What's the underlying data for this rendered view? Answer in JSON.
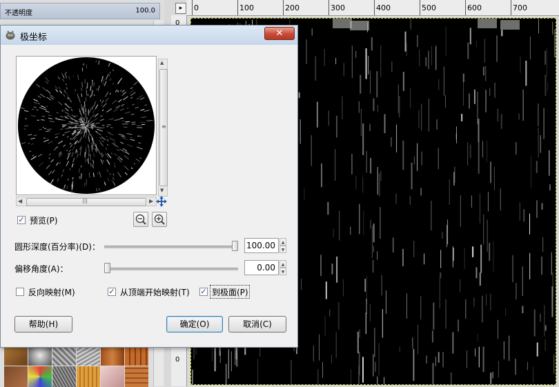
{
  "background": {
    "layers_panel": {
      "opacity_label": "不透明度",
      "opacity_value": "100.0"
    },
    "ruler": {
      "top_labels": [
        "0",
        "100",
        "200",
        "300",
        "400",
        "500",
        "600",
        "700"
      ],
      "left_labels": [
        "0",
        "0",
        "0"
      ],
      "corner_glyph": "▸"
    }
  },
  "dialog": {
    "title": "极坐标",
    "close_glyph": "✕",
    "scroll_grip_v": "≡",
    "scroll_grip_h": "|||",
    "nav_glyph": "✥",
    "preview": {
      "label": "预览(P)",
      "checked": true
    },
    "sliders": [
      {
        "label": "圆形深度(百分率)(D)：",
        "value": "100.00",
        "fraction": 1.0
      },
      {
        "label": "偏移角度(A)：",
        "value": "0.00",
        "fraction": 0.0
      }
    ],
    "options": [
      {
        "label": "反向映射(M)",
        "checked": false
      },
      {
        "label": "从顶端开始映射(T)",
        "checked": true
      },
      {
        "label": "到极面(P)",
        "checked": true
      }
    ],
    "buttons": {
      "help": "帮助(H)",
      "ok": "确定(O)",
      "cancel": "取消(C)"
    }
  }
}
